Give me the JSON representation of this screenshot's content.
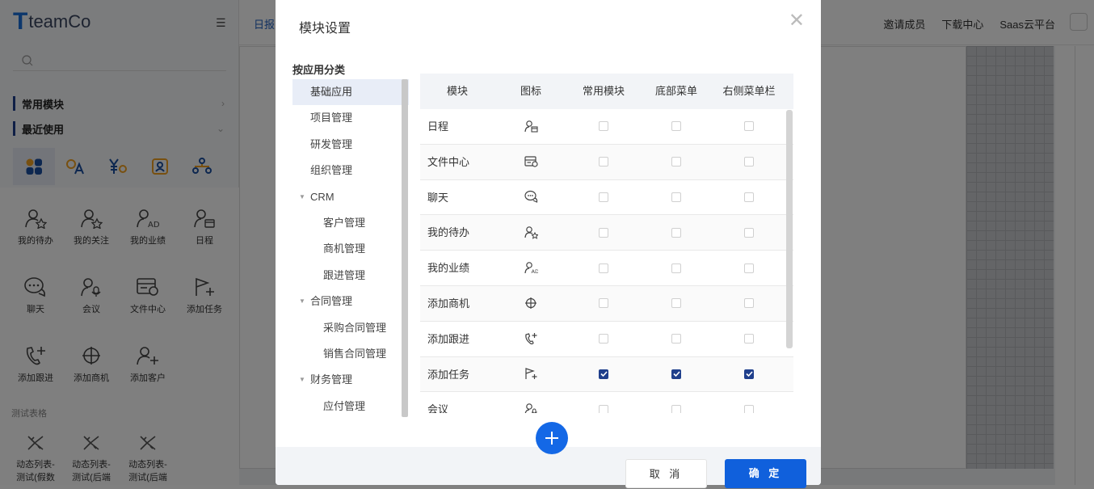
{
  "app": {
    "logo_letter": "T",
    "logo_text": "teamCo",
    "brand_color": "#1a6fd8"
  },
  "sidebar": {
    "sections": [
      {
        "label": "常用模块"
      },
      {
        "label": "最近使用"
      }
    ],
    "modules": [
      {
        "label": "我的待办",
        "icon": "user-star-icon"
      },
      {
        "label": "我的关注",
        "icon": "user-star-icon"
      },
      {
        "label": "我的业绩",
        "icon": "user-ad-icon"
      },
      {
        "label": "日程",
        "icon": "calendar-user-icon"
      },
      {
        "label": "聊天",
        "icon": "chat-icon"
      },
      {
        "label": "会议",
        "icon": "meeting-icon"
      },
      {
        "label": "文件中心",
        "icon": "file-center-icon"
      },
      {
        "label": "添加任务",
        "icon": "flag-plus-icon"
      },
      {
        "label": "添加跟进",
        "icon": "phone-plus-icon"
      },
      {
        "label": "添加商机",
        "icon": "crosshair-icon"
      },
      {
        "label": "添加客户",
        "icon": "user-plus-icon"
      }
    ],
    "test_heading": "测试表格",
    "test_items": [
      {
        "label1": "动态列表-",
        "label2": "测试(假数"
      },
      {
        "label1": "动态列表-",
        "label2": "测试(后端"
      },
      {
        "label1": "动态列表-",
        "label2": "测试(后端"
      }
    ]
  },
  "topbar": {
    "left_label": "日报",
    "right_links": [
      "邀请成员",
      "下载中心",
      "Saas云平台"
    ]
  },
  "modal": {
    "title": "模块设置",
    "category_title": "按应用分类",
    "categories": [
      {
        "label": "基础应用",
        "active": true
      },
      {
        "label": "项目管理"
      },
      {
        "label": "研发管理"
      },
      {
        "label": "组织管理"
      },
      {
        "label": "CRM",
        "expanded": true
      },
      {
        "label": "客户管理",
        "sub": true
      },
      {
        "label": "商机管理",
        "sub": true
      },
      {
        "label": "跟进管理",
        "sub": true
      },
      {
        "label": "合同管理",
        "expanded": true
      },
      {
        "label": "采购合同管理",
        "sub": true
      },
      {
        "label": "销售合同管理",
        "sub": true
      },
      {
        "label": "财务管理",
        "expanded": true
      },
      {
        "label": "应付管理",
        "sub": true
      }
    ],
    "columns": [
      "模块",
      "图标",
      "常用模块",
      "底部菜单",
      "右侧菜单栏"
    ],
    "rows": [
      {
        "name": "日程",
        "icon": "calendar-user-icon",
        "common": false,
        "bottom": false,
        "right": false
      },
      {
        "name": "文件中心",
        "icon": "file-center-icon",
        "common": false,
        "bottom": false,
        "right": false
      },
      {
        "name": "聊天",
        "icon": "chat-icon",
        "common": false,
        "bottom": false,
        "right": false
      },
      {
        "name": "我的待办",
        "icon": "user-star-icon",
        "common": false,
        "bottom": false,
        "right": false
      },
      {
        "name": "我的业绩",
        "icon": "user-ad-icon",
        "common": false,
        "bottom": false,
        "right": false
      },
      {
        "name": "添加商机",
        "icon": "crosshair-icon",
        "common": false,
        "bottom": false,
        "right": false
      },
      {
        "name": "添加跟进",
        "icon": "phone-plus-icon",
        "common": false,
        "bottom": false,
        "right": false
      },
      {
        "name": "添加任务",
        "icon": "flag-plus-icon",
        "common": true,
        "bottom": true,
        "right": true
      },
      {
        "name": "会议",
        "icon": "meeting-icon",
        "common": false,
        "bottom": false,
        "right": false
      }
    ],
    "cancel_label": "取 消",
    "ok_label": "确 定",
    "accent": "#1060dc"
  }
}
